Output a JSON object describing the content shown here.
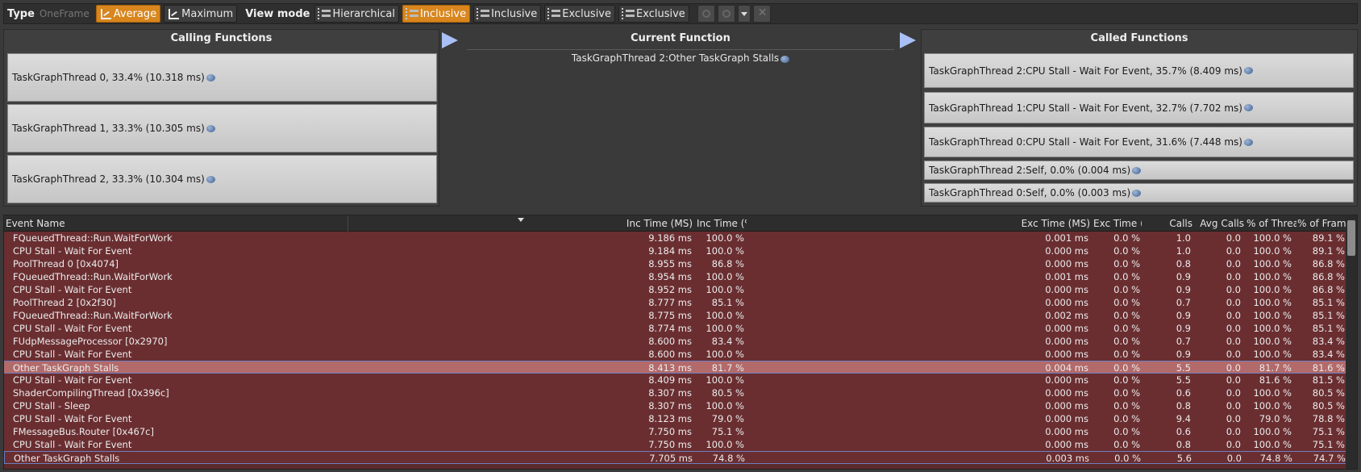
{
  "toolbar": {
    "type_label": "Type",
    "oneframe_label": "OneFrame",
    "average_label": "Average",
    "maximum_label": "Maximum",
    "viewmode_label": "View mode",
    "hierarchical_label": "Hierarchical",
    "inclusive_active_label": "Inclusive",
    "inclusive_label": "Inclusive",
    "exclusive_label_1": "Exclusive",
    "exclusive_label_2": "Exclusive"
  },
  "calling": {
    "title": "Calling Functions",
    "items": [
      {
        "label": "TaskGraphThread 0, 33.4% (10.318 ms)"
      },
      {
        "label": "TaskGraphThread 1, 33.3% (10.305 ms)"
      },
      {
        "label": "TaskGraphThread 2, 33.3% (10.304 ms)"
      }
    ]
  },
  "current": {
    "title": "Current Function",
    "name": "TaskGraphThread 2:Other TaskGraph Stalls"
  },
  "called": {
    "title": "Called Functions",
    "items": [
      {
        "label": "TaskGraphThread 2:CPU Stall - Wait For Event, 35.7% (8.409 ms)"
      },
      {
        "label": "TaskGraphThread 1:CPU Stall - Wait For Event, 32.7% (7.702 ms)"
      },
      {
        "label": "TaskGraphThread 0:CPU Stall - Wait For Event, 31.6% (7.448 ms)"
      },
      {
        "label": "TaskGraphThread 2:Self, 0.0% (0.004 ms)"
      },
      {
        "label": "TaskGraphThread 0:Self, 0.0% (0.003 ms)"
      }
    ]
  },
  "table": {
    "columns": {
      "event_name": "Event Name",
      "inc_time_ms": "Inc Time (MS)",
      "inc_time_pct": "Inc Time (%",
      "exc_time_ms": "Exc Time (MS)",
      "exc_time_pct": "Exc Time (%",
      "calls": "Calls",
      "avg_calls": "Avg Calls",
      "pct_thread": "% of Threac",
      "pct_frame": "% of Frame"
    },
    "rows": [
      {
        "name": "FQueuedThread::Run.WaitForWork",
        "inc_ms": "9.186 ms",
        "inc_pct": "100.0 %",
        "exc_ms": "0.001 ms",
        "exc_pct": "0.0 %",
        "calls": "1.0",
        "avg": "0.0",
        "thread": "100.0 %",
        "frame": "89.1 %"
      },
      {
        "name": "CPU Stall - Wait For Event",
        "inc_ms": "9.184 ms",
        "inc_pct": "100.0 %",
        "exc_ms": "0.000 ms",
        "exc_pct": "0.0 %",
        "calls": "1.0",
        "avg": "0.0",
        "thread": "100.0 %",
        "frame": "89.1 %"
      },
      {
        "name": "PoolThread 0 [0x4074]",
        "inc_ms": "8.955 ms",
        "inc_pct": "86.8 %",
        "exc_ms": "0.000 ms",
        "exc_pct": "0.0 %",
        "calls": "0.8",
        "avg": "0.0",
        "thread": "100.0 %",
        "frame": "86.8 %"
      },
      {
        "name": "FQueuedThread::Run.WaitForWork",
        "inc_ms": "8.954 ms",
        "inc_pct": "100.0 %",
        "exc_ms": "0.001 ms",
        "exc_pct": "0.0 %",
        "calls": "0.9",
        "avg": "0.0",
        "thread": "100.0 %",
        "frame": "86.8 %"
      },
      {
        "name": "CPU Stall - Wait For Event",
        "inc_ms": "8.952 ms",
        "inc_pct": "100.0 %",
        "exc_ms": "0.000 ms",
        "exc_pct": "0.0 %",
        "calls": "0.9",
        "avg": "0.0",
        "thread": "100.0 %",
        "frame": "86.8 %"
      },
      {
        "name": "PoolThread 2 [0x2f30]",
        "inc_ms": "8.777 ms",
        "inc_pct": "85.1 %",
        "exc_ms": "0.000 ms",
        "exc_pct": "0.0 %",
        "calls": "0.7",
        "avg": "0.0",
        "thread": "100.0 %",
        "frame": "85.1 %"
      },
      {
        "name": "FQueuedThread::Run.WaitForWork",
        "inc_ms": "8.775 ms",
        "inc_pct": "100.0 %",
        "exc_ms": "0.002 ms",
        "exc_pct": "0.0 %",
        "calls": "0.9",
        "avg": "0.0",
        "thread": "100.0 %",
        "frame": "85.1 %"
      },
      {
        "name": "CPU Stall - Wait For Event",
        "inc_ms": "8.774 ms",
        "inc_pct": "100.0 %",
        "exc_ms": "0.000 ms",
        "exc_pct": "0.0 %",
        "calls": "0.9",
        "avg": "0.0",
        "thread": "100.0 %",
        "frame": "85.1 %"
      },
      {
        "name": "FUdpMessageProcessor [0x2970]",
        "inc_ms": "8.600 ms",
        "inc_pct": "83.4 %",
        "exc_ms": "0.000 ms",
        "exc_pct": "0.0 %",
        "calls": "0.7",
        "avg": "0.0",
        "thread": "100.0 %",
        "frame": "83.4 %"
      },
      {
        "name": "CPU Stall - Wait For Event",
        "inc_ms": "8.600 ms",
        "inc_pct": "100.0 %",
        "exc_ms": "0.000 ms",
        "exc_pct": "0.0 %",
        "calls": "0.9",
        "avg": "0.0",
        "thread": "100.0 %",
        "frame": "83.4 %"
      },
      {
        "name": "Other TaskGraph Stalls",
        "inc_ms": "8.413 ms",
        "inc_pct": "81.7 %",
        "exc_ms": "0.004 ms",
        "exc_pct": "0.0 %",
        "calls": "5.5",
        "avg": "0.0",
        "thread": "81.7 %",
        "frame": "81.6 %",
        "selected": true
      },
      {
        "name": "CPU Stall - Wait For Event",
        "inc_ms": "8.409 ms",
        "inc_pct": "100.0 %",
        "exc_ms": "0.000 ms",
        "exc_pct": "0.0 %",
        "calls": "5.5",
        "avg": "0.0",
        "thread": "81.6 %",
        "frame": "81.5 %"
      },
      {
        "name": "ShaderCompilingThread [0x396c]",
        "inc_ms": "8.307 ms",
        "inc_pct": "80.5 %",
        "exc_ms": "0.000 ms",
        "exc_pct": "0.0 %",
        "calls": "0.6",
        "avg": "0.0",
        "thread": "100.0 %",
        "frame": "80.5 %"
      },
      {
        "name": "CPU Stall - Sleep",
        "inc_ms": "8.307 ms",
        "inc_pct": "100.0 %",
        "exc_ms": "0.000 ms",
        "exc_pct": "0.0 %",
        "calls": "0.8",
        "avg": "0.0",
        "thread": "100.0 %",
        "frame": "80.5 %"
      },
      {
        "name": "CPU Stall - Wait For Event",
        "inc_ms": "8.123 ms",
        "inc_pct": "79.0 %",
        "exc_ms": "0.000 ms",
        "exc_pct": "0.0 %",
        "calls": "9.4",
        "avg": "0.0",
        "thread": "79.0 %",
        "frame": "78.8 %"
      },
      {
        "name": "FMessageBus.Router [0x467c]",
        "inc_ms": "7.750 ms",
        "inc_pct": "75.1 %",
        "exc_ms": "0.000 ms",
        "exc_pct": "0.0 %",
        "calls": "0.6",
        "avg": "0.0",
        "thread": "100.0 %",
        "frame": "75.1 %"
      },
      {
        "name": "CPU Stall - Wait For Event",
        "inc_ms": "7.750 ms",
        "inc_pct": "100.0 %",
        "exc_ms": "0.000 ms",
        "exc_pct": "0.0 %",
        "calls": "0.8",
        "avg": "0.0",
        "thread": "100.0 %",
        "frame": "75.1 %"
      },
      {
        "name": "Other TaskGraph Stalls",
        "inc_ms": "7.705 ms",
        "inc_pct": "74.8 %",
        "exc_ms": "0.003 ms",
        "exc_pct": "0.0 %",
        "calls": "5.6",
        "avg": "0.0",
        "thread": "74.8 %",
        "frame": "74.7 %"
      }
    ]
  }
}
